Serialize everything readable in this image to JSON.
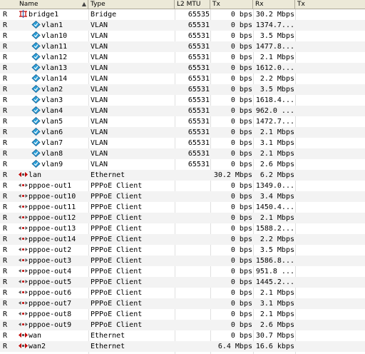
{
  "columns": {
    "name": "Name",
    "type": "Type",
    "mtu": "L2 MTU",
    "tx": "Tx",
    "rx": "Rx",
    "extra": "Tx"
  },
  "rows": [
    {
      "flag": "R",
      "name": "bridge1",
      "type": "Bridge",
      "mtu": "65535",
      "tx": "0 bps",
      "rx": "30.2 Mbps",
      "icon": "bridge-icon",
      "indent": false
    },
    {
      "flag": "R",
      "name": "vlan1",
      "type": "VLAN",
      "mtu": "65531",
      "tx": "0 bps",
      "rx": "1374.7...",
      "icon": "vlan-icon",
      "indent": true
    },
    {
      "flag": "R",
      "name": "vlan10",
      "type": "VLAN",
      "mtu": "65531",
      "tx": "0 bps",
      "rx": "3.5 Mbps",
      "icon": "vlan-icon",
      "indent": true
    },
    {
      "flag": "R",
      "name": "vlan11",
      "type": "VLAN",
      "mtu": "65531",
      "tx": "0 bps",
      "rx": "1477.8...",
      "icon": "vlan-icon",
      "indent": true
    },
    {
      "flag": "R",
      "name": "vlan12",
      "type": "VLAN",
      "mtu": "65531",
      "tx": "0 bps",
      "rx": "2.1 Mbps",
      "icon": "vlan-icon",
      "indent": true
    },
    {
      "flag": "R",
      "name": "vlan13",
      "type": "VLAN",
      "mtu": "65531",
      "tx": "0 bps",
      "rx": "1612.0...",
      "icon": "vlan-icon",
      "indent": true
    },
    {
      "flag": "R",
      "name": "vlan14",
      "type": "VLAN",
      "mtu": "65531",
      "tx": "0 bps",
      "rx": "2.2 Mbps",
      "icon": "vlan-icon",
      "indent": true
    },
    {
      "flag": "R",
      "name": "vlan2",
      "type": "VLAN",
      "mtu": "65531",
      "tx": "0 bps",
      "rx": "3.5 Mbps",
      "icon": "vlan-icon",
      "indent": true
    },
    {
      "flag": "R",
      "name": "vlan3",
      "type": "VLAN",
      "mtu": "65531",
      "tx": "0 bps",
      "rx": "1618.4...",
      "icon": "vlan-icon",
      "indent": true
    },
    {
      "flag": "R",
      "name": "vlan4",
      "type": "VLAN",
      "mtu": "65531",
      "tx": "0 bps",
      "rx": "962.0 ...",
      "icon": "vlan-icon",
      "indent": true
    },
    {
      "flag": "R",
      "name": "vlan5",
      "type": "VLAN",
      "mtu": "65531",
      "tx": "0 bps",
      "rx": "1472.7...",
      "icon": "vlan-icon",
      "indent": true
    },
    {
      "flag": "R",
      "name": "vlan6",
      "type": "VLAN",
      "mtu": "65531",
      "tx": "0 bps",
      "rx": "2.1 Mbps",
      "icon": "vlan-icon",
      "indent": true
    },
    {
      "flag": "R",
      "name": "vlan7",
      "type": "VLAN",
      "mtu": "65531",
      "tx": "0 bps",
      "rx": "3.1 Mbps",
      "icon": "vlan-icon",
      "indent": true
    },
    {
      "flag": "R",
      "name": "vlan8",
      "type": "VLAN",
      "mtu": "65531",
      "tx": "0 bps",
      "rx": "2.1 Mbps",
      "icon": "vlan-icon",
      "indent": true
    },
    {
      "flag": "R",
      "name": "vlan9",
      "type": "VLAN",
      "mtu": "65531",
      "tx": "0 bps",
      "rx": "2.6 Mbps",
      "icon": "vlan-icon",
      "indent": true
    },
    {
      "flag": "R",
      "name": "lan",
      "type": "Ethernet",
      "mtu": "",
      "tx": "30.2 Mbps",
      "rx": "6.2 Mbps",
      "icon": "ethernet-icon",
      "indent": false
    },
    {
      "flag": "R",
      "name": "pppoe-out1",
      "type": "PPPoE Client",
      "mtu": "",
      "tx": "0 bps",
      "rx": "1349.0...",
      "icon": "pppoe-icon",
      "indent": false
    },
    {
      "flag": "R",
      "name": "pppoe-out10",
      "type": "PPPoE Client",
      "mtu": "",
      "tx": "0 bps",
      "rx": "3.4 Mbps",
      "icon": "pppoe-icon",
      "indent": false
    },
    {
      "flag": "R",
      "name": "pppoe-out11",
      "type": "PPPoE Client",
      "mtu": "",
      "tx": "0 bps",
      "rx": "1450.4...",
      "icon": "pppoe-icon",
      "indent": false
    },
    {
      "flag": "R",
      "name": "pppoe-out12",
      "type": "PPPoE Client",
      "mtu": "",
      "tx": "0 bps",
      "rx": "2.1 Mbps",
      "icon": "pppoe-icon",
      "indent": false
    },
    {
      "flag": "R",
      "name": "pppoe-out13",
      "type": "PPPoE Client",
      "mtu": "",
      "tx": "0 bps",
      "rx": "1588.2...",
      "icon": "pppoe-icon",
      "indent": false
    },
    {
      "flag": "R",
      "name": "pppoe-out14",
      "type": "PPPoE Client",
      "mtu": "",
      "tx": "0 bps",
      "rx": "2.2 Mbps",
      "icon": "pppoe-icon",
      "indent": false
    },
    {
      "flag": "R",
      "name": "pppoe-out2",
      "type": "PPPoE Client",
      "mtu": "",
      "tx": "0 bps",
      "rx": "3.5 Mbps",
      "icon": "pppoe-icon",
      "indent": false
    },
    {
      "flag": "R",
      "name": "pppoe-out3",
      "type": "PPPoE Client",
      "mtu": "",
      "tx": "0 bps",
      "rx": "1586.8...",
      "icon": "pppoe-icon",
      "indent": false
    },
    {
      "flag": "R",
      "name": "pppoe-out4",
      "type": "PPPoE Client",
      "mtu": "",
      "tx": "0 bps",
      "rx": "951.8 ...",
      "icon": "pppoe-icon",
      "indent": false
    },
    {
      "flag": "R",
      "name": "pppoe-out5",
      "type": "PPPoE Client",
      "mtu": "",
      "tx": "0 bps",
      "rx": "1445.2...",
      "icon": "pppoe-icon",
      "indent": false
    },
    {
      "flag": "R",
      "name": "pppoe-out6",
      "type": "PPPoE Client",
      "mtu": "",
      "tx": "0 bps",
      "rx": "2.1 Mbps",
      "icon": "pppoe-icon",
      "indent": false
    },
    {
      "flag": "R",
      "name": "pppoe-out7",
      "type": "PPPoE Client",
      "mtu": "",
      "tx": "0 bps",
      "rx": "3.1 Mbps",
      "icon": "pppoe-icon",
      "indent": false
    },
    {
      "flag": "R",
      "name": "pppoe-out8",
      "type": "PPPoE Client",
      "mtu": "",
      "tx": "0 bps",
      "rx": "2.1 Mbps",
      "icon": "pppoe-icon",
      "indent": false
    },
    {
      "flag": "R",
      "name": "pppoe-out9",
      "type": "PPPoE Client",
      "mtu": "",
      "tx": "0 bps",
      "rx": "2.6 Mbps",
      "icon": "pppoe-icon",
      "indent": false
    },
    {
      "flag": "R",
      "name": "wan",
      "type": "Ethernet",
      "mtu": "",
      "tx": "0 bps",
      "rx": "30.7 Mbps",
      "icon": "ethernet-icon",
      "indent": false
    },
    {
      "flag": "R",
      "name": "wan2",
      "type": "Ethernet",
      "mtu": "",
      "tx": "6.4 Mbps",
      "rx": "16.6 kbps",
      "icon": "ethernet-icon",
      "indent": false
    }
  ],
  "colors": {
    "header_bg": "#ece9d8",
    "icon_red": "#c00000",
    "icon_blue": "#2a5fb0",
    "icon_gray": "#555555"
  }
}
